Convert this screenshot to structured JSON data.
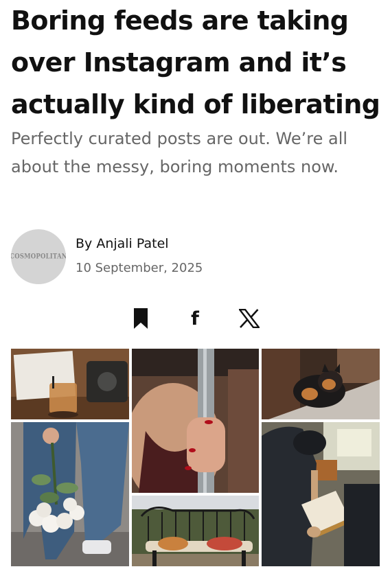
{
  "article": {
    "headline": "Boring feeds are taking over Instagram and it’s actually kind of liberating",
    "dek": "Perfectly curated posts are out. We’re all about the messy, boring moments now."
  },
  "byline": {
    "avatar_text": "COSMOPOLITAN",
    "author": "By Anjali Patel",
    "date": "10 September, 2025"
  },
  "share": {
    "icons": [
      "bookmark-icon",
      "facebook-icon",
      "x-icon"
    ],
    "facebook_glyph": "f"
  },
  "collage": {
    "photos": [
      "cafe-table-drink-photo",
      "woman-red-nails-pole-photo",
      "cat-on-ledge-photo",
      "person-holding-white-roses-photo",
      "man-reading-book-photo",
      "cat-on-bench-photo"
    ]
  }
}
